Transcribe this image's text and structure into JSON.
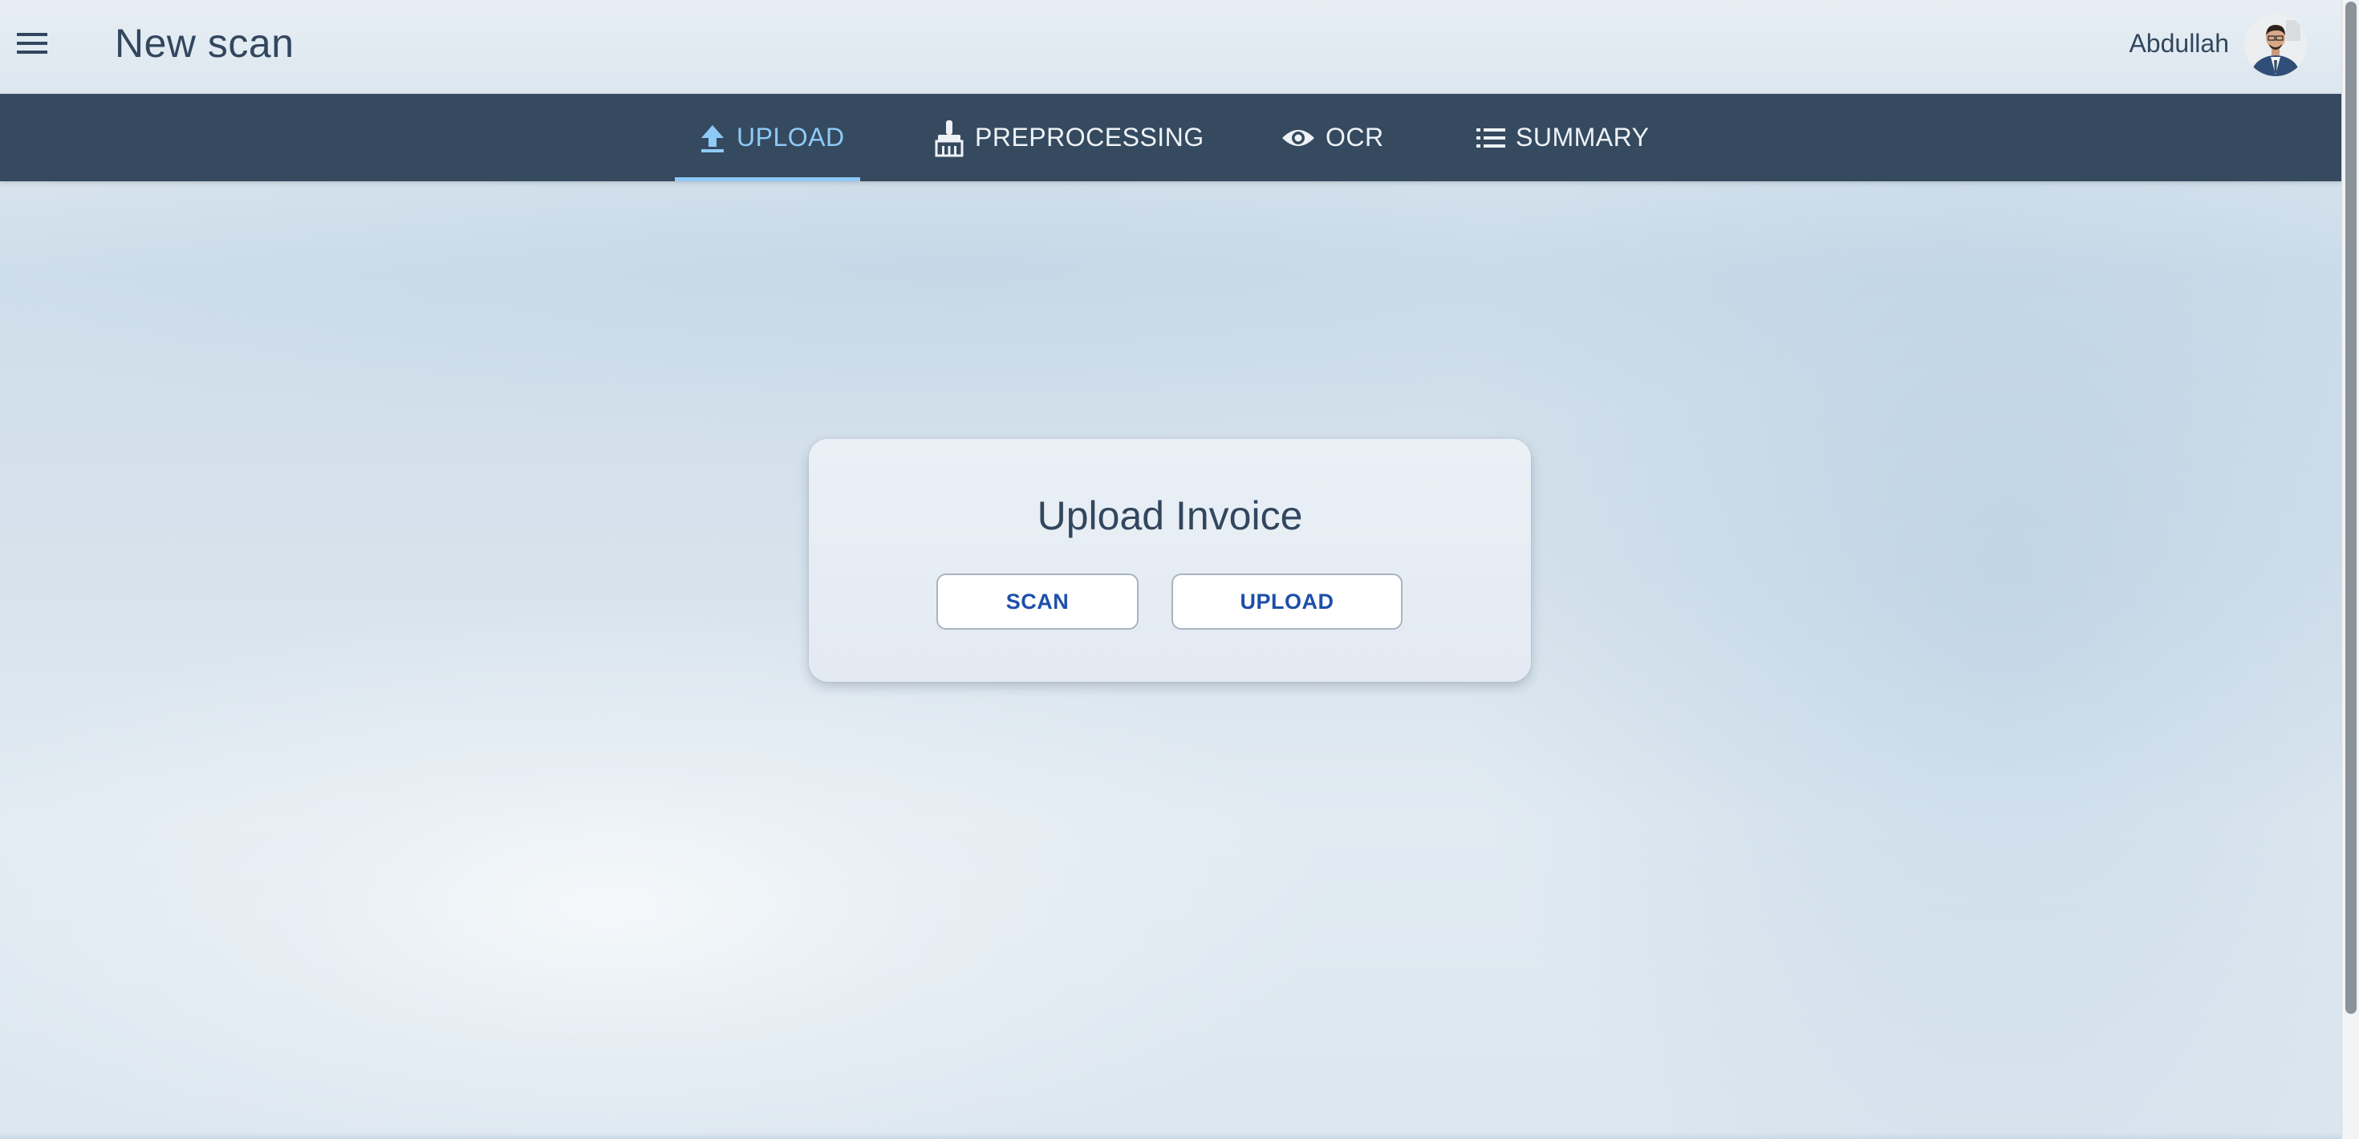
{
  "header": {
    "title": "New scan",
    "menu_icon": "hamburger-menu-icon",
    "user": {
      "name": "Abdullah",
      "avatar_icon": "user-avatar"
    }
  },
  "tabs": [
    {
      "label": "UPLOAD",
      "icon": "upload-icon",
      "active": true
    },
    {
      "label": "PREPROCESSING",
      "icon": "broom-icon",
      "active": false
    },
    {
      "label": "OCR",
      "icon": "eye-icon",
      "active": false
    },
    {
      "label": "SUMMARY",
      "icon": "list-icon",
      "active": false
    }
  ],
  "card": {
    "title": "Upload Invoice",
    "buttons": {
      "scan_label": "SCAN",
      "upload_label": "UPLOAD"
    }
  },
  "colors": {
    "tabbar_bg": "#354a5f",
    "active_tab": "#8fcaf7",
    "button_text": "#1d4fa8",
    "title_text": "#32475e"
  }
}
